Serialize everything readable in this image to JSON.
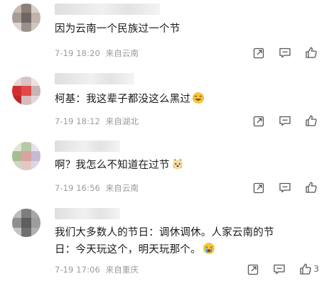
{
  "comments": [
    {
      "text": "因为云南一个民族过一个节",
      "time": "7-19 18:20",
      "location": "来自云南",
      "like_count": ""
    },
    {
      "text": "柯基：我这辈子都没这么黑过",
      "time": "7-19 18:12",
      "location": "来自湖北",
      "like_count": ""
    },
    {
      "text": "啊？我怎么不知道在过节",
      "time": "7-19 16:56",
      "location": "来自云南",
      "like_count": ""
    },
    {
      "text_line1": "我们大多数人的节日：调休调休。人家云南的节",
      "text_line2": "日：今天玩这个，明天玩那个。",
      "time": "7-19 17:06",
      "location": "来自重庆",
      "like_count": "3"
    }
  ],
  "icons": {
    "repost": "repost-icon",
    "comment": "comment-icon",
    "like": "like-icon",
    "emoji_laugh_cry": "laugh-cry-emoji",
    "emoji_dog": "dog-emoji",
    "emoji_cry": "cry-emoji"
  },
  "colors": {
    "text": "#1a1a1a",
    "meta": "#9b9b9b",
    "icon": "#555555",
    "emoji": "#f7c637"
  }
}
